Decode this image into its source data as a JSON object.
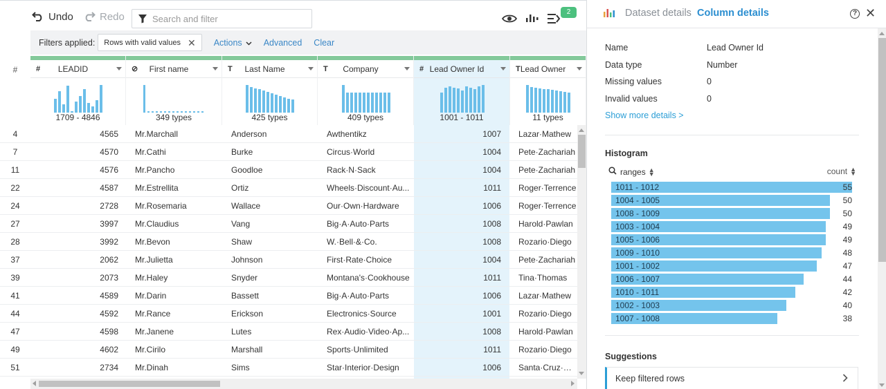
{
  "toolbar": {
    "undo_label": "Undo",
    "redo_label": "Redo",
    "search_placeholder": "Search and filter",
    "badge_count": "2"
  },
  "filters": {
    "label": "Filters applied:",
    "chip": "Rows with valid values",
    "actions": "Actions",
    "advanced": "Advanced",
    "clear": "Clear"
  },
  "grid": {
    "rownum_header": "#",
    "columns": [
      {
        "type": "#",
        "name": "LEADID",
        "summary": "1709 - 4846",
        "spark": [
          0.5,
          0.78,
          0.3,
          0.98,
          0.05,
          0.4,
          0.6,
          0.85,
          0.35,
          0.22,
          0.45,
          1.0
        ]
      },
      {
        "type": "⊘",
        "name": "First name",
        "summary": "349 types",
        "spark": [
          1.0,
          0.04,
          0.04,
          0.04,
          0.04,
          0.04,
          0.04,
          0.04,
          0.04,
          0.04,
          0.04,
          0.04,
          0.04,
          0.04,
          0.04
        ]
      },
      {
        "type": "T",
        "name": "Last Name",
        "summary": "425 types",
        "spark": [
          1.0,
          0.92,
          0.88,
          0.84,
          0.8,
          0.75,
          0.7,
          0.66,
          0.6,
          0.55,
          0.5,
          0.48
        ]
      },
      {
        "type": "T",
        "name": "Company",
        "summary": "409 types",
        "spark": [
          1.0,
          0.72,
          0.72,
          0.72,
          0.72,
          0.72,
          0.72,
          0.72,
          0.72,
          0.72,
          0.72,
          0.72
        ]
      },
      {
        "type": "#",
        "name": "Lead Owner Id",
        "summary": "1001 - 1011",
        "spark": [
          0.72,
          0.9,
          0.95,
          0.9,
          0.88,
          0.8,
          0.95,
          0.9,
          0.85,
          0.95,
          1.0
        ]
      },
      {
        "type": "T",
        "name": "Lead Owner",
        "summary": "11 types",
        "spark": [
          1.0,
          0.92,
          0.9,
          0.88,
          0.86,
          0.84,
          0.82,
          0.8,
          0.78,
          0.75,
          0.72
        ]
      }
    ],
    "rows": [
      [
        "4",
        "4565",
        "Mr.Marchall",
        "Anderson",
        "Awthentikz",
        "1007",
        "Lazar·Mathew"
      ],
      [
        "7",
        "4570",
        "Mr.Cathi",
        "Burke",
        "Circus·World",
        "1004",
        "Pete·Zachariah"
      ],
      [
        "11",
        "4576",
        "Mr.Pancho",
        "Goodloe",
        "Rack·N·Sack",
        "1004",
        "Pete·Zachariah"
      ],
      [
        "22",
        "4587",
        "Mr.Estrellita",
        "Ortiz",
        "Wheels·Discount·Au...",
        "1011",
        "Roger·Terrence"
      ],
      [
        "24",
        "2728",
        "Mr.Rosemaria",
        "Wallace",
        "Our·Own·Hardware",
        "1006",
        "Roger·Terrence"
      ],
      [
        "27",
        "3997",
        "Mr.Claudius",
        "Vang",
        "Big·A·Auto·Parts",
        "1008",
        "Harold·Pawlan"
      ],
      [
        "28",
        "3992",
        "Mr.Bevon",
        "Shaw",
        "W.·Bell·&·Co.",
        "1008",
        "Rozario·Diego"
      ],
      [
        "37",
        "2062",
        "Mr.Julietta",
        "Johnson",
        "First·Rate·Choice",
        "1004",
        "Pete·Zachariah"
      ],
      [
        "39",
        "2073",
        "Mr.Haley",
        "Snyder",
        "Montana's·Cookhouse",
        "1011",
        "Tina·Thomas"
      ],
      [
        "41",
        "4589",
        "Mr.Darin",
        "Bassett",
        "Big·A·Auto·Parts",
        "1006",
        "Lazar·Mathew"
      ],
      [
        "44",
        "4592",
        "Mr.Rance",
        "Erickson",
        "Electronics·Source",
        "1001",
        "Rozario·Diego"
      ],
      [
        "47",
        "4598",
        "Mr.Janene",
        "Lutes",
        "Rex·Audio·Video·Ap...",
        "1008",
        "Harold·Pawlan"
      ],
      [
        "49",
        "4602",
        "Mr.Cirilo",
        "Marshall",
        "Sports·Unlimited",
        "1011",
        "Rozario·Diego"
      ],
      [
        "51",
        "2734",
        "Mr.Dinah",
        "Sims",
        "Star·Interior·Design",
        "1006",
        "Santa·Cruz·Clara"
      ]
    ]
  },
  "panel": {
    "tab_dataset": "Dataset details",
    "tab_column": "Column details",
    "help": "?",
    "details": [
      {
        "k": "Name",
        "v": "Lead Owner Id"
      },
      {
        "k": "Data type",
        "v": "Number"
      },
      {
        "k": "Missing values",
        "v": "0"
      },
      {
        "k": "Invalid values",
        "v": "0"
      }
    ],
    "show_more": "Show more details >",
    "histogram_title": "Histogram",
    "hist_col_left": "ranges",
    "hist_col_right": "count",
    "suggestions_title": "Suggestions",
    "suggestion_item": "Keep filtered rows"
  },
  "chart_data": {
    "type": "bar",
    "orientation": "horizontal",
    "title": "Histogram",
    "categories": [
      "1011 - 1012",
      "1004 - 1005",
      "1008 - 1009",
      "1003 - 1004",
      "1005 - 1006",
      "1009 - 1010",
      "1001 - 1002",
      "1006 - 1007",
      "1010 - 1011",
      "1002 - 1003",
      "1007 - 1008"
    ],
    "values": [
      55,
      50,
      50,
      49,
      49,
      48,
      47,
      44,
      42,
      40,
      38
    ],
    "xlabel": "count",
    "ylabel": "ranges"
  },
  "colors": {
    "accent": "#2b8ed0",
    "bar": "#74c4ec",
    "header_bar": "#83c99a",
    "badge": "#4cc07e",
    "selected_col": "#e4f3fb"
  }
}
